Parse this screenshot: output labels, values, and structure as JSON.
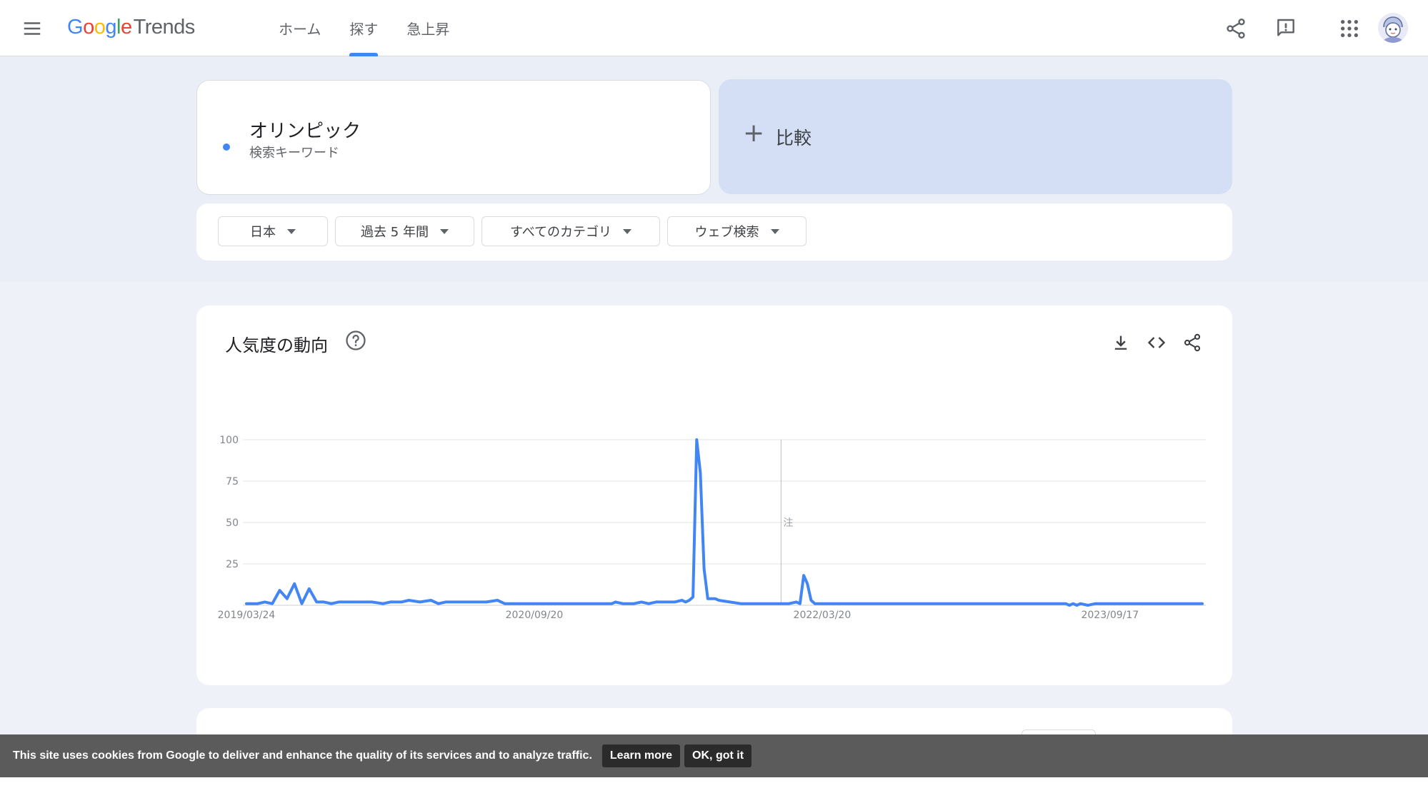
{
  "header": {
    "logo_google": "Google",
    "logo_trends": "Trends",
    "nav": [
      {
        "label": "ホーム"
      },
      {
        "label": "探す"
      },
      {
        "label": "急上昇"
      }
    ],
    "active_nav": "探す",
    "accent_color": "#4285f4"
  },
  "search": {
    "term": "オリンピック",
    "term_type": "検索キーワード",
    "term_color": "#4285f4",
    "compare_label": "比較",
    "compare_icon": "plus-icon"
  },
  "filters": {
    "region": "日本",
    "period": "過去 5 年間",
    "category": "すべてのカテゴリ",
    "search_type": "ウェブ検索"
  },
  "trend_card": {
    "title": "人気度の動向",
    "icons": [
      "help-icon",
      "download-icon",
      "embed-icon",
      "share-icon"
    ]
  },
  "chart_data": {
    "type": "line",
    "title": "",
    "xlabel": "",
    "ylabel": "",
    "ylim": [
      0,
      100
    ],
    "yticks": [
      25,
      50,
      75,
      100
    ],
    "x_tick_labels": [
      "2019/03/24",
      "2020/09/20",
      "2022/03/20",
      "2023/09/17"
    ],
    "grid": true,
    "annotation": "注",
    "series": [
      {
        "color": "#4285f4",
        "points": [
          [
            "2019/03/24",
            1
          ],
          [
            "2019/04/14",
            1
          ],
          [
            "2019/04/28",
            2
          ],
          [
            "2019/05/12",
            1
          ],
          [
            "2019/05/26",
            9
          ],
          [
            "2019/06/09",
            4
          ],
          [
            "2019/06/23",
            13
          ],
          [
            "2019/07/07",
            1
          ],
          [
            "2019/07/21",
            10
          ],
          [
            "2019/08/04",
            2
          ],
          [
            "2019/08/18",
            2
          ],
          [
            "2019/09/01",
            1
          ],
          [
            "2019/09/15",
            2
          ],
          [
            "2019/10/06",
            2
          ],
          [
            "2019/10/27",
            2
          ],
          [
            "2019/11/17",
            2
          ],
          [
            "2019/12/08",
            1
          ],
          [
            "2019/12/22",
            2
          ],
          [
            "2020/01/12",
            2
          ],
          [
            "2020/01/26",
            3
          ],
          [
            "2020/02/16",
            2
          ],
          [
            "2020/03/08",
            3
          ],
          [
            "2020/03/22",
            1
          ],
          [
            "2020/04/05",
            2
          ],
          [
            "2020/05/10",
            2
          ],
          [
            "2020/05/31",
            2
          ],
          [
            "2020/06/21",
            2
          ],
          [
            "2020/07/12",
            3
          ],
          [
            "2020/07/26",
            1
          ],
          [
            "2020/09/20",
            1
          ],
          [
            "2021/01/03",
            1
          ],
          [
            "2021/02/14",
            1
          ],
          [
            "2021/02/21",
            2
          ],
          [
            "2021/03/07",
            1
          ],
          [
            "2021/03/28",
            1
          ],
          [
            "2021/04/11",
            2
          ],
          [
            "2021/04/25",
            1
          ],
          [
            "2021/05/09",
            2
          ],
          [
            "2021/05/30",
            2
          ],
          [
            "2021/06/13",
            2
          ],
          [
            "2021/06/27",
            3
          ],
          [
            "2021/07/04",
            2
          ],
          [
            "2021/07/11",
            3
          ],
          [
            "2021/07/18",
            5
          ],
          [
            "2021/07/25",
            100
          ],
          [
            "2021/08/01",
            80
          ],
          [
            "2021/08/08",
            22
          ],
          [
            "2021/08/15",
            4
          ],
          [
            "2021/08/29",
            4
          ],
          [
            "2021/09/05",
            3
          ],
          [
            "2021/09/26",
            2
          ],
          [
            "2021/10/17",
            1
          ],
          [
            "2022/01/16",
            1
          ],
          [
            "2022/01/30",
            2
          ],
          [
            "2022/02/06",
            1
          ],
          [
            "2022/02/13",
            18
          ],
          [
            "2022/02/20",
            13
          ],
          [
            "2022/02/27",
            3
          ],
          [
            "2022/03/06",
            1
          ],
          [
            "2023/06/25",
            1
          ],
          [
            "2023/07/02",
            0
          ],
          [
            "2023/07/09",
            1
          ],
          [
            "2023/07/16",
            0
          ],
          [
            "2023/07/23",
            1
          ],
          [
            "2023/08/06",
            0
          ],
          [
            "2023/08/20",
            1
          ],
          [
            "2024/03/10",
            1
          ]
        ]
      }
    ]
  },
  "cookie_bar": {
    "text": "This site uses cookies from Google to deliver and enhance the quality of its services and to analyze traffic.",
    "learn_more": "Learn more",
    "ok": "OK, got it"
  }
}
